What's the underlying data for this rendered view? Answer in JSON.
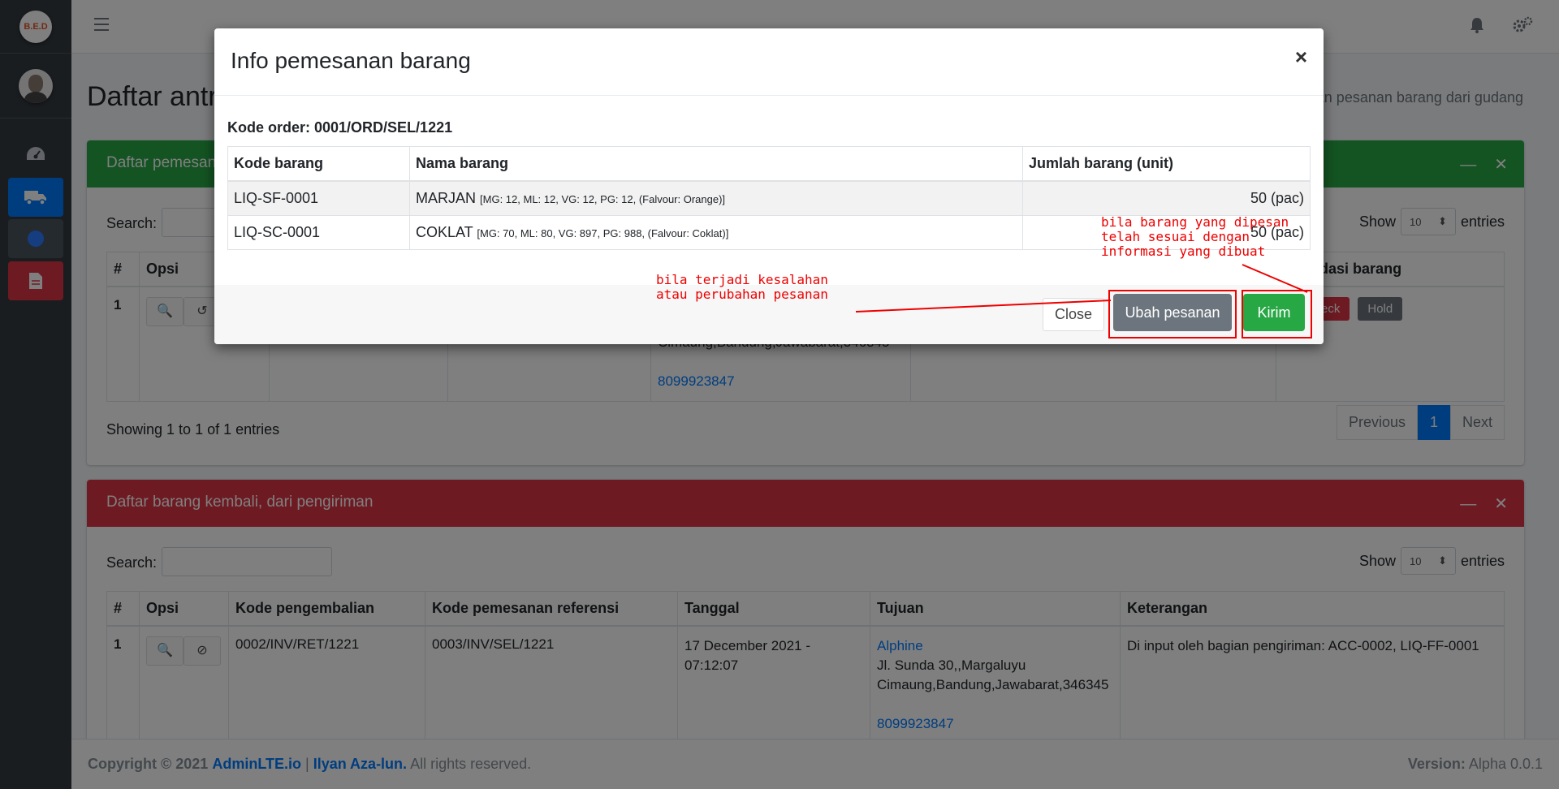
{
  "brand": {
    "logo_text": "B.E.D"
  },
  "page": {
    "title": "Daftar antrian",
    "breadcrumb": "an pesanan barang dari gudang"
  },
  "card1": {
    "header": "Daftar pemesanan",
    "search_label": "Search:",
    "show_label": "Show",
    "show_value": "10",
    "entries_label": "entries",
    "columns": [
      "#",
      "Opsi",
      "s validasi barang"
    ],
    "row": {
      "num": "1",
      "address_tail": "Cimaung,Bandung,Jawabarat,346345",
      "phone": "8099923847",
      "uncheck": "Uncheck",
      "hold": "Hold"
    },
    "showing": "Showing 1 to 1 of 1 entries",
    "pager": {
      "prev": "Previous",
      "page": "1",
      "next": "Next"
    }
  },
  "card2": {
    "header": "Daftar barang kembali, dari pengiriman",
    "search_label": "Search:",
    "show_label": "Show",
    "show_value": "10",
    "entries_label": "entries",
    "columns": [
      "#",
      "Opsi",
      "Kode pengembalian",
      "Kode pemesanan referensi",
      "Tanggal",
      "Tujuan",
      "Keterangan"
    ],
    "row": {
      "num": "1",
      "kode_pengembalian": "0002/INV/RET/1221",
      "kode_referensi": "0003/INV/SEL/1221",
      "tanggal": "17 December 2021 - 07:12:07",
      "tujuan_name": "Alphine",
      "tujuan_addr1": "Jl. Sunda 30,,Margaluyu",
      "tujuan_addr2": "Cimaung,Bandung,Jawabarat,346345",
      "tujuan_phone": "8099923847",
      "keterangan": "Di input oleh bagian pengiriman: ACC-0002, LIQ-FF-0001"
    }
  },
  "footer": {
    "copyright": "Copyright © 2021",
    "link1": "AdminLTE.io",
    "sep": "|",
    "link2": "Ilyan Aza-lun.",
    "rights": "All rights reserved.",
    "version_label": "Version:",
    "version_value": "Alpha 0.0.1"
  },
  "modal": {
    "title": "Info pemesanan barang",
    "close_symbol": "×",
    "kode_order": "Kode order: 0001/ORD/SEL/1221",
    "columns": [
      "Kode barang",
      "Nama barang",
      "Jumlah barang (unit)"
    ],
    "rows": [
      {
        "kode": "LIQ-SF-0001",
        "nama": "MARJAN",
        "spec": "[MG: 12, ML: 12, VG: 12, PG: 12, (Falvour: Orange)]",
        "jumlah": "50 (pac)"
      },
      {
        "kode": "LIQ-SC-0001",
        "nama": "COKLAT",
        "spec": "[MG: 70, ML: 80, VG: 897, PG: 988, (Falvour: Coklat)]",
        "jumlah": "50 (pac)"
      }
    ],
    "btn_close": "Close",
    "btn_ubah": "Ubah pesanan",
    "btn_kirim": "Kirim"
  },
  "annotations": {
    "left_text": "bila terjadi kesalahan\natau perubahan pesanan",
    "right_text": "bila barang yang dipesan\ntelah sesuai dengan\ninformasi yang dibuat",
    "color": "#e00000"
  }
}
